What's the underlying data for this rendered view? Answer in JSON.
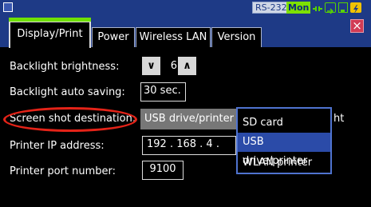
{
  "statusbar": {
    "interface_badge": "RS-232C",
    "monitor_badge": "Mon",
    "icons": [
      "plug-icon",
      "usb-icon",
      "lan-icon",
      "bolt-icon"
    ]
  },
  "tabs": [
    {
      "label": "Display/Print",
      "active": true
    },
    {
      "label": "Power",
      "active": false
    },
    {
      "label": "Wireless LAN",
      "active": false
    },
    {
      "label": "Version",
      "active": false
    }
  ],
  "close_symbol": "×",
  "settings": {
    "backlight_brightness": {
      "label": "Backlight brightness:",
      "value": "6",
      "down": "∨",
      "up": "∧"
    },
    "backlight_auto_saving": {
      "label": "Backlight auto saving:",
      "value": "30 sec."
    },
    "screen_shot_destination": {
      "label": "Screen shot destination:",
      "value": "USB drive/printer",
      "trailing_text": "ht"
    },
    "printer_ip": {
      "label": "Printer IP address:",
      "value": "192 . 168 . 4 ."
    },
    "printer_port": {
      "label": "Printer port number:",
      "value": "9100"
    }
  },
  "dropdown": {
    "options": [
      "SD card",
      "USB drive/printer",
      "WLAN printer"
    ],
    "selected": "USB drive/printer"
  },
  "colors": {
    "header_blue": "#1e3a86",
    "active_green": "#6fe000",
    "highlight_red": "#e42318",
    "selection_blue": "#2b4ba8"
  }
}
